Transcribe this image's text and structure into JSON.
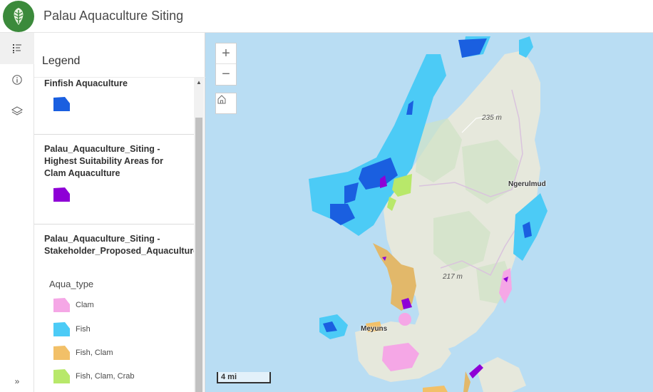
{
  "header": {
    "title": "Palau Aquaculture Siting",
    "logo_icon": "leaf-logo-icon"
  },
  "rail": {
    "items": [
      {
        "name": "legend-icon",
        "active": true
      },
      {
        "name": "info-icon",
        "active": false
      },
      {
        "name": "layers-icon",
        "active": false
      }
    ],
    "collapse_label": "»"
  },
  "legend": {
    "title": "Legend",
    "layers": [
      {
        "title": "Finfish Aquaculture",
        "symbol_color": "#1a5fe0"
      },
      {
        "title": "Palau_Aquaculture_Siting - Highest Suitability Areas for Clam Aquaculture",
        "symbol_color": "#8e00d6"
      },
      {
        "title": "Palau_Aquaculture_Siting - Stakeholder_Proposed_Aquaculture_Areas",
        "field": "Aqua_type",
        "classes": [
          {
            "label": "Clam",
            "color": "#f5a7e6"
          },
          {
            "label": "Fish",
            "color": "#4ccbf6"
          },
          {
            "label": "Fish, Clam",
            "color": "#f2c068"
          },
          {
            "label": "Fish, Clam, Crab",
            "color": "#b8e86a"
          }
        ]
      }
    ]
  },
  "map": {
    "zoom_in": "+",
    "zoom_out": "−",
    "home_icon": "home-icon",
    "scale_label": "4 mi",
    "labels": {
      "elev1": "235 m",
      "elev2": "217 m",
      "place1": "Ngerulmud",
      "place2": "Meyuns"
    },
    "colors": {
      "water": "#b9ddf3",
      "land": "#e6e8dc"
    }
  }
}
